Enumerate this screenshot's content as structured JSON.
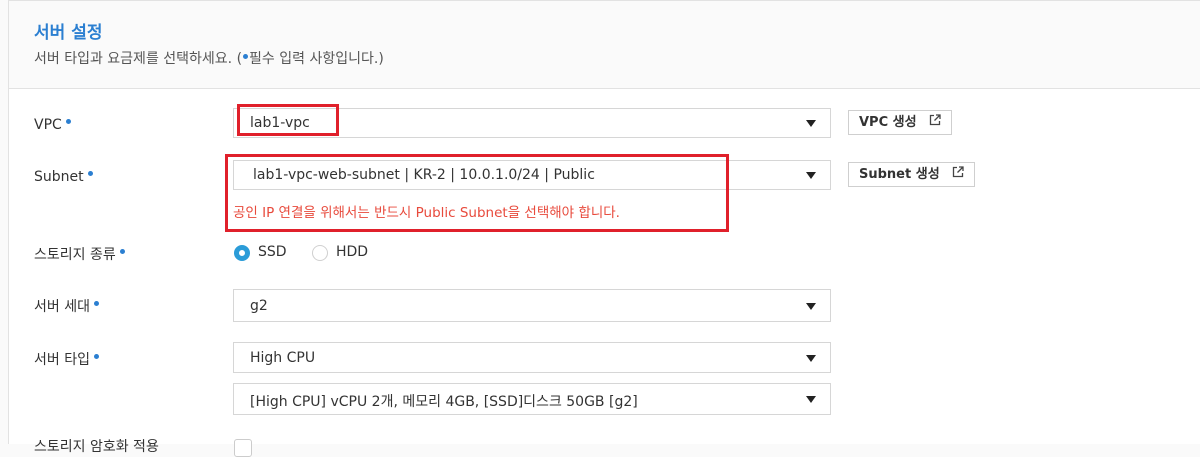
{
  "header": {
    "title": "서버 설정",
    "subtitle_before": "서버 타입과 요금제를 선택하세요. (",
    "subtitle_after": "필수 입력 사항입니다.)"
  },
  "fields": {
    "vpc": {
      "label": "VPC",
      "value": "lab1-vpc",
      "button_label": "VPC 생성"
    },
    "subnet": {
      "label": "Subnet",
      "value": "lab1-vpc-web-subnet | KR-2 | 10.0.1.0/24 | Public",
      "button_label": "Subnet 생성",
      "warning": "공인 IP 연결을 위해서는 반드시 Public Subnet을 선택해야 합니다."
    },
    "storage": {
      "label": "스토리지 종류",
      "options": [
        "SSD",
        "HDD"
      ],
      "selected": "SSD"
    },
    "generation": {
      "label": "서버 세대",
      "value": "g2"
    },
    "server_type": {
      "label": "서버 타입",
      "value": "High CPU",
      "spec": "[High CPU] vCPU 2개, 메모리 4GB, [SSD]디스크 50GB [g2]"
    },
    "partial_label": "스토리지 암호화 적용"
  },
  "colors": {
    "accent": "#2b7fd1",
    "highlight": "#e0202b",
    "warning": "#e84a3c"
  },
  "icons": {
    "external_link": "external-link-icon",
    "dropdown": "caret-down-icon"
  }
}
